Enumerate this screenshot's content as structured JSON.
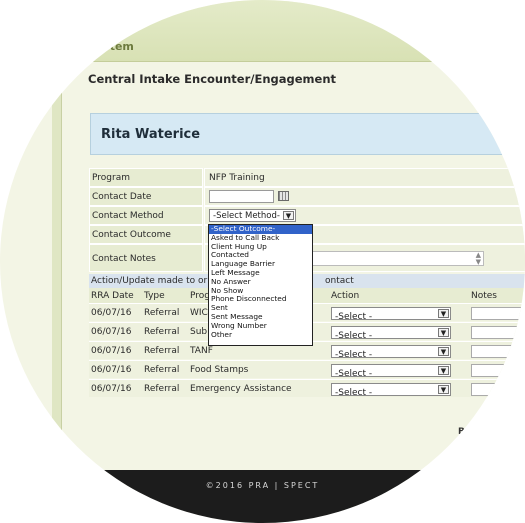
{
  "header": {
    "system_label": "ystem"
  },
  "page_title": "Central Intake Encounter/Engagement",
  "client_name": "Rita Waterice",
  "form": {
    "program_label": "Program",
    "program_value": "NFP Training",
    "contact_date_label": "Contact Date",
    "contact_date_value": "",
    "contact_method_label": "Contact Method",
    "contact_method_value": "-Select Method-",
    "contact_outcome_label": "Contact Outcome",
    "contact_notes_label": "Contact Notes",
    "contact_notes_value": ""
  },
  "outcome_dropdown": {
    "options": [
      "-Select Outcome-",
      "Asked to Call Back",
      "Client Hung Up",
      "Contacted",
      "Language Barrier",
      "Left Message",
      "No Answer",
      "No Show",
      "Phone Disconnected",
      "Sent",
      "Sent Message",
      "Wrong Number",
      "Other"
    ],
    "highlighted": "-Select Outcome-"
  },
  "referrals": {
    "section_title": "Action/Update made to or",
    "section_title_tail": "ontact",
    "columns": {
      "date": "RRA Date",
      "type": "Type",
      "program": "Prog",
      "action": "Action",
      "notes": "Notes"
    },
    "rows": [
      {
        "date": "06/07/16",
        "type": "Referral",
        "program": "WIC",
        "action": "-Select -"
      },
      {
        "date": "06/07/16",
        "type": "Referral",
        "program": "Sub",
        "action": "-Select -"
      },
      {
        "date": "06/07/16",
        "type": "Referral",
        "program": "TANF",
        "action": "-Select -"
      },
      {
        "date": "06/07/16",
        "type": "Referral",
        "program": "Food Stamps",
        "action": "-Select -"
      },
      {
        "date": "06/07/16",
        "type": "Referral",
        "program": "Emergency Assistance",
        "action": "-Select -"
      }
    ]
  },
  "partial_button_text": "B",
  "footer": {
    "copyright": "©2016 PRA | SPECT"
  }
}
